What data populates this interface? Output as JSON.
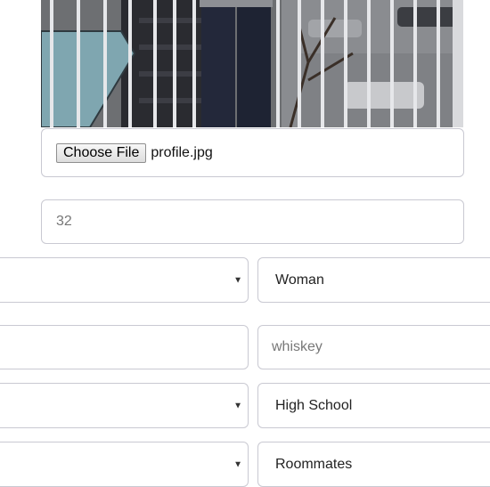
{
  "photo": {
    "icon": "profile-photo-image"
  },
  "file_input": {
    "button_label": "Choose File",
    "file_name": "profile.jpg"
  },
  "age_input": {
    "value": "32"
  },
  "rows": [
    {
      "left_select_value": "",
      "right_select_value": "Woman"
    },
    {
      "left_input_value": "",
      "right_input_placeholder": "whiskey"
    },
    {
      "left_select_value": "",
      "right_select_value": "High School"
    },
    {
      "left_select_value": "",
      "right_select_value": "Roommates"
    }
  ],
  "caret_glyph": "▼",
  "colors": {
    "field_border": "#c9c9d2",
    "text": "#222222",
    "placeholder": "#777777"
  }
}
